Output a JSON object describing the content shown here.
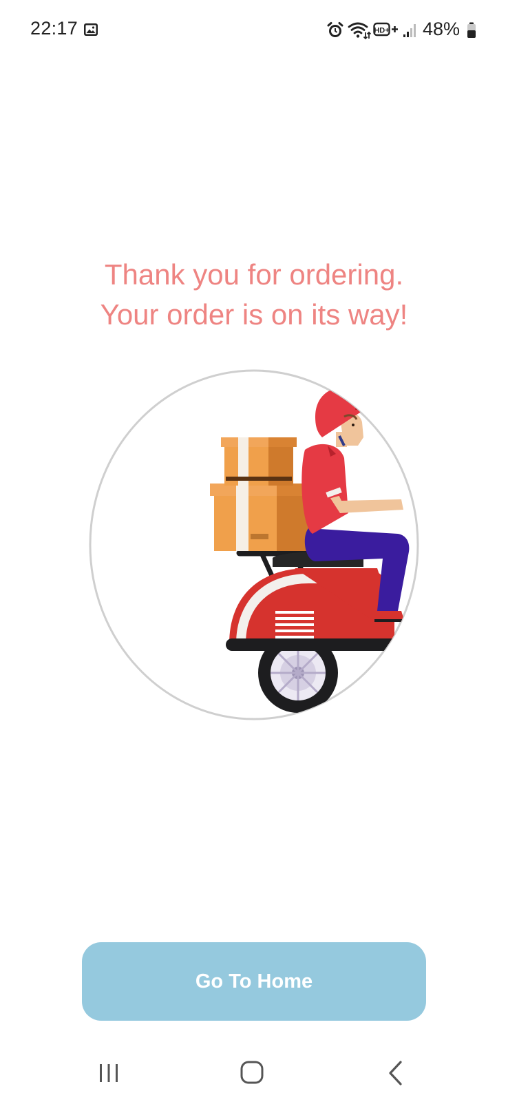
{
  "status_bar": {
    "time": "22:17",
    "battery_percent": "48%",
    "network_label": "HD+",
    "icons": [
      "gallery-icon",
      "alarm-icon",
      "wifi-icon",
      "hd-plus-icon",
      "signal-icon",
      "battery-icon"
    ]
  },
  "message": {
    "line1": "Thank you for ordering.",
    "line2": "Your order is on its way!",
    "color": "#ee8482"
  },
  "illustration": {
    "subject": "delivery-scooter-rider"
  },
  "button": {
    "label": "Go To Home",
    "color": "#95c9de"
  },
  "nav_bar": {
    "icons": [
      "recents-icon",
      "home-icon",
      "back-icon"
    ]
  }
}
